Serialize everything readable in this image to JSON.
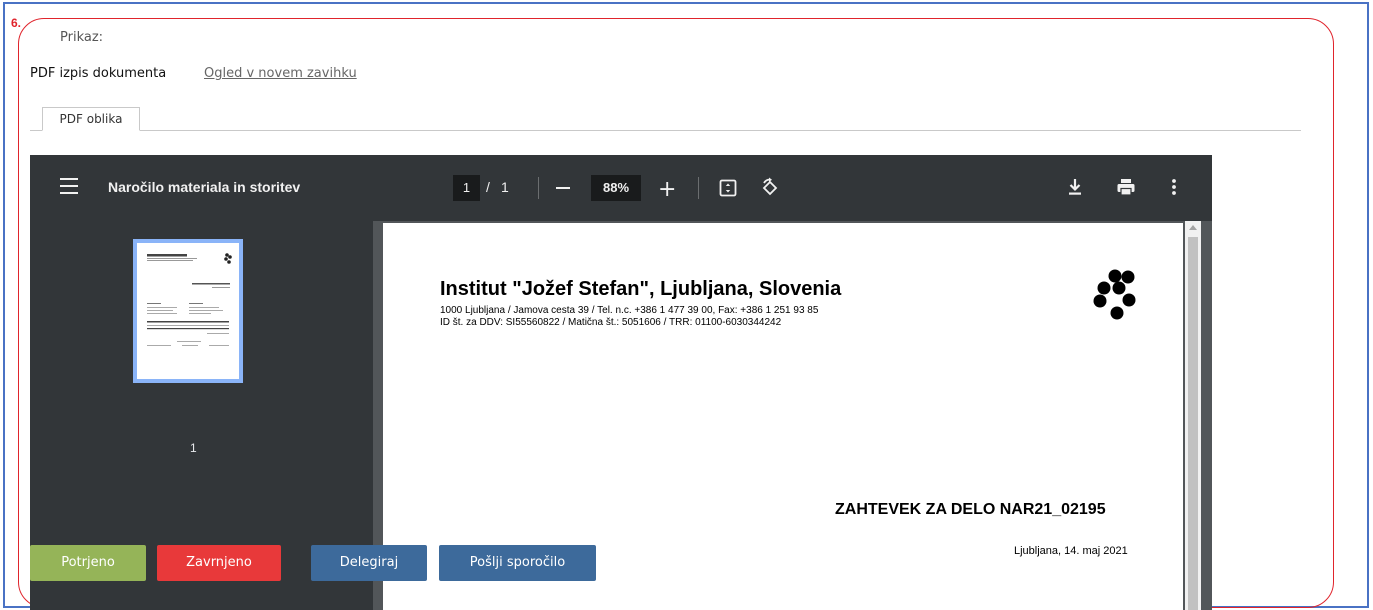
{
  "annotation": {
    "step_number": "6."
  },
  "section": {
    "label": "Prikaz:",
    "pdf_label": "PDF izpis dokumenta",
    "open_link": "Ogled v novem zavihku",
    "tabs": [
      {
        "label": "PDF oblika",
        "active": true
      }
    ]
  },
  "viewer": {
    "title": "Naročilo materiala in storitev",
    "page_current": "1",
    "page_separator": "/",
    "page_total": "1",
    "zoom": "88%",
    "thumbnail_label": "1",
    "icons": [
      "menu-icon",
      "zoom-out-icon",
      "zoom-in-icon",
      "fit-page-icon",
      "rotate-icon",
      "download-icon",
      "print-icon",
      "more-vert-icon"
    ]
  },
  "document": {
    "institution": "Institut \"Jožef Stefan\", Ljubljana, Slovenia",
    "address": "1000 Ljubljana / Jamova cesta 39 /  Tel. n.c. +386 1 477 39 00, Fax: +386 1 251 93 85",
    "ids": "ID št. za DDV: SI55560822 / Matična št.: 5051606 / TRR: 01100-6030344242",
    "request_title": "ZAHTEVEK ZA DELO NAR21_02195",
    "date_line": "Ljubljana, 14. maj 2021"
  },
  "actions": {
    "confirm": "Potrjeno",
    "reject": "Zavrnjeno",
    "delegate": "Delegiraj",
    "send_message": "Pošlji sporočilo"
  },
  "colors": {
    "frame": "#4a72c4",
    "annotation": "#e0242c",
    "confirm": "#95b458",
    "reject": "#e8393a",
    "neutral_action": "#3d6a9b",
    "viewer_toolbar": "#323639",
    "thumbnail_highlight": "#8ab4f8"
  }
}
